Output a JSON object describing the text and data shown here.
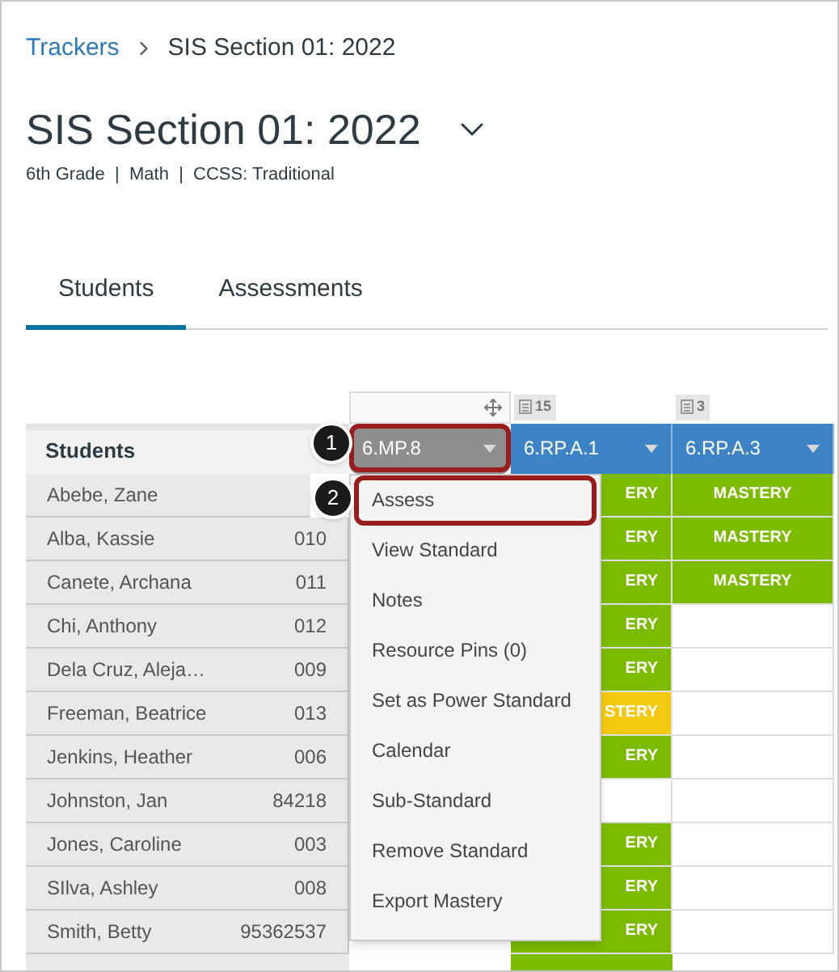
{
  "breadcrumb": [
    {
      "label": "Trackers",
      "kind": "link"
    },
    {
      "label": "SIS Section 01: 2022",
      "kind": "current"
    }
  ],
  "title": "SIS Section 01: 2022",
  "subtitle": "6th Grade  |  Math  |  CCSS: Traditional",
  "tabs": [
    {
      "label": "Students",
      "selected": true
    },
    {
      "label": "Assessments",
      "selected": false
    }
  ],
  "table": {
    "students_header": "Students",
    "columns": [
      {
        "label": "6.MP.8",
        "selected": true
      },
      {
        "label": "6.RP.A.1",
        "selected": false,
        "count": "15"
      },
      {
        "label": "6.RP.A.3",
        "selected": false,
        "count": "3"
      }
    ],
    "rows": [
      {
        "name": "Abebe, Zane",
        "cells": [
          {
            "text": "ERY",
            "color": "#7cbb00"
          },
          {
            "text": "MASTERY",
            "color": "#7cbb00"
          }
        ]
      },
      {
        "name": "Alba, Kassie",
        "student_number": "010",
        "cells": [
          {
            "text": "ERY",
            "color": "#7cbb00"
          },
          {
            "text": "MASTERY",
            "color": "#7cbb00"
          }
        ]
      },
      {
        "name": "Canete, Archana",
        "student_number": "011",
        "cells": [
          {
            "text": "ERY",
            "color": "#7cbb00"
          },
          {
            "text": "MASTERY",
            "color": "#7cbb00"
          }
        ]
      },
      {
        "name": "Chi, Anthony",
        "student_number": "012",
        "cells": [
          {
            "text": "ERY",
            "color": "#7cbb00"
          },
          null
        ]
      },
      {
        "name": "Dela Cruz, Aleja…",
        "student_number": "009",
        "cells": [
          {
            "text": "ERY",
            "color": "#7cbb00"
          },
          null
        ]
      },
      {
        "name": "Freeman, Beatrice",
        "student_number": "013",
        "cells": [
          {
            "text": "STERY",
            "color": "#f2c811"
          },
          null
        ]
      },
      {
        "name": "Jenkins, Heather",
        "student_number": "006",
        "cells": [
          {
            "text": "ERY",
            "color": "#7cbb00"
          },
          null
        ]
      },
      {
        "name": "Johnston, Jan",
        "student_number": "84218",
        "cells": [
          null,
          null
        ]
      },
      {
        "name": "Jones, Caroline",
        "student_number": "003",
        "cells": [
          {
            "text": "ERY",
            "color": "#7cbb00"
          },
          null
        ]
      },
      {
        "name": "SIlva, Ashley",
        "student_number": "008",
        "cells": [
          {
            "text": "ERY",
            "color": "#7cbb00"
          },
          null
        ]
      },
      {
        "name": "Smith, Betty",
        "student_number": "95362537",
        "cells": [
          {
            "text": "ERY",
            "color": "#7cbb00"
          },
          null
        ]
      }
    ]
  },
  "menu": [
    {
      "label": "Assess",
      "highlighted": true
    },
    {
      "label": "View Standard",
      "highlighted": false
    },
    {
      "label": "Notes",
      "highlighted": false
    },
    {
      "label": "Resource Pins (0)",
      "highlighted": false
    },
    {
      "label": "Set as Power Standard",
      "highlighted": false
    },
    {
      "label": "Calendar",
      "highlighted": false
    },
    {
      "label": "Sub-Standard",
      "highlighted": false
    },
    {
      "label": "Remove Standard",
      "highlighted": false
    },
    {
      "label": "Export Mastery",
      "highlighted": false
    }
  ],
  "callouts": [
    "1",
    "2"
  ]
}
